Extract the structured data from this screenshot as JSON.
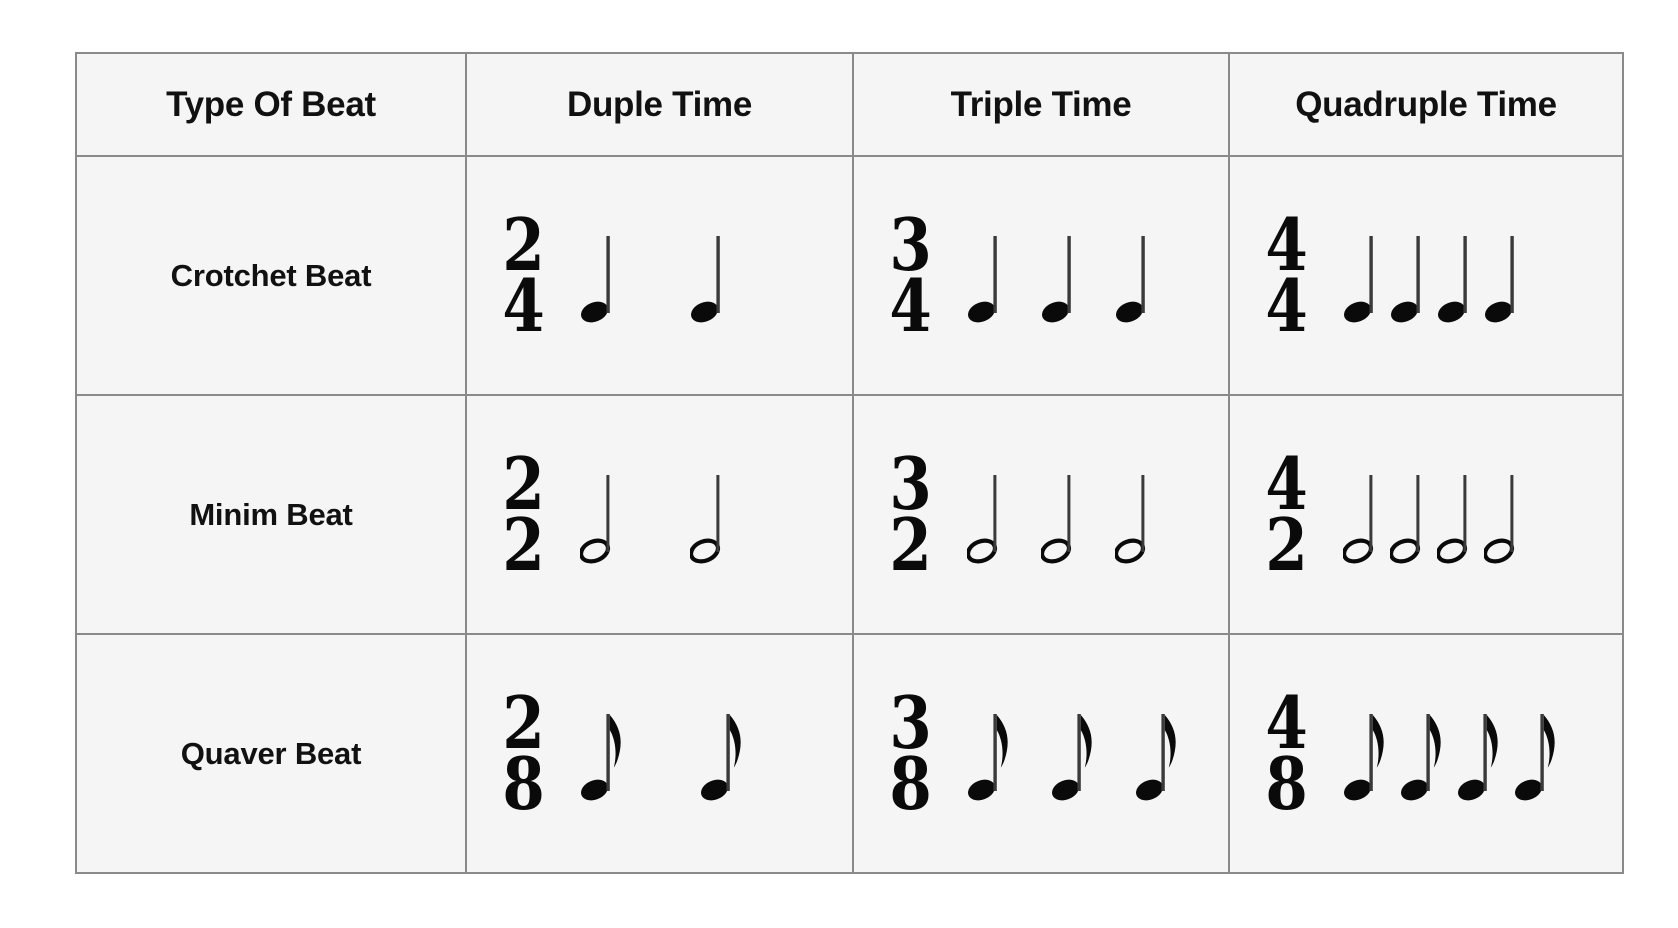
{
  "table": {
    "headers": [
      {
        "label": "Type Of Beat"
      },
      {
        "label": "Duple Time"
      },
      {
        "label": "Triple Time"
      },
      {
        "label": "Quadruple Time"
      }
    ],
    "rows": [
      {
        "label": "Crotchet Beat",
        "cells": [
          {
            "time_signature": "2/4",
            "numerator": "2",
            "denominator": "4",
            "note_type": "crotchet",
            "note_count": 2,
            "spacing": "sp-wide"
          },
          {
            "time_signature": "3/4",
            "numerator": "3",
            "denominator": "4",
            "note_type": "crotchet",
            "note_count": 3,
            "spacing": "sp-med"
          },
          {
            "time_signature": "4/4",
            "numerator": "4",
            "denominator": "4",
            "note_type": "crotchet",
            "note_count": 4,
            "spacing": "sp-tight"
          }
        ]
      },
      {
        "label": "Minim Beat",
        "cells": [
          {
            "time_signature": "2/2",
            "numerator": "2",
            "denominator": "2",
            "note_type": "minim",
            "note_count": 2,
            "spacing": "sp-wide"
          },
          {
            "time_signature": "3/2",
            "numerator": "3",
            "denominator": "2",
            "note_type": "minim",
            "note_count": 3,
            "spacing": "sp-med"
          },
          {
            "time_signature": "4/2",
            "numerator": "4",
            "denominator": "2",
            "note_type": "minim",
            "note_count": 4,
            "spacing": "sp-tight"
          }
        ]
      },
      {
        "label": "Quaver Beat",
        "cells": [
          {
            "time_signature": "2/8",
            "numerator": "2",
            "denominator": "8",
            "note_type": "quaver",
            "note_count": 2,
            "spacing": "sp-wide"
          },
          {
            "time_signature": "3/8",
            "numerator": "3",
            "denominator": "8",
            "note_type": "quaver",
            "note_count": 3,
            "spacing": "sp-med"
          },
          {
            "time_signature": "4/8",
            "numerator": "4",
            "denominator": "8",
            "note_type": "quaver",
            "note_count": 4,
            "spacing": "sp-tight"
          }
        ]
      }
    ]
  },
  "style": {
    "page_background": "#ffffff",
    "cell_background": "#f5f5f5",
    "border_color": "#8a8a8a",
    "text_color": "#111111",
    "note_color": "#0a0a0a"
  }
}
